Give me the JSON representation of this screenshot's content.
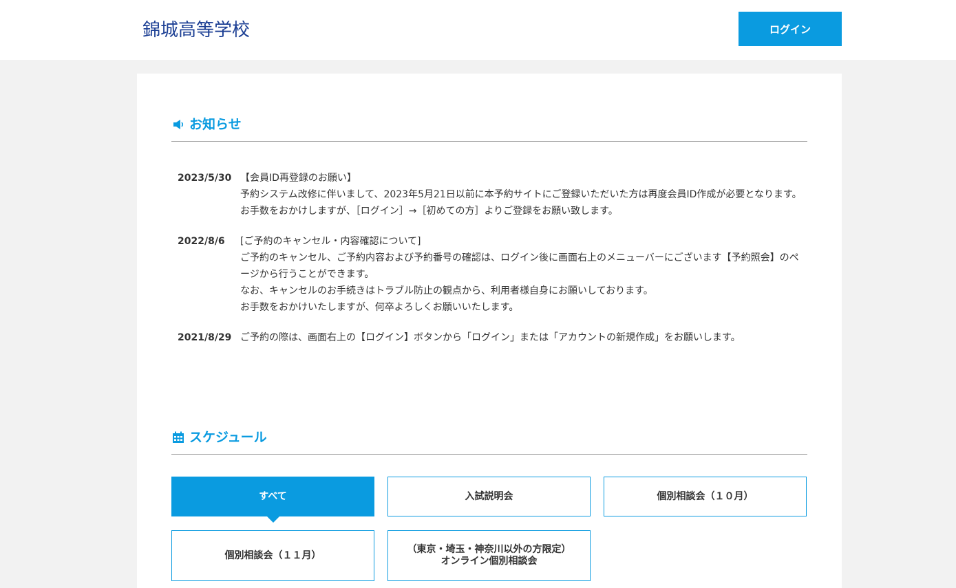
{
  "header": {
    "logo": "錦城高等学校",
    "login_label": "ログイン"
  },
  "colors": {
    "accent": "#0a9be0",
    "logo": "#1c3f94",
    "background": "#f2f2f2"
  },
  "news": {
    "title": "お知らせ",
    "icon": "megaphone-icon",
    "items": [
      {
        "date": "2023/5/30",
        "lines": [
          "【会員ID再登録のお願い】",
          "予約システム改修に伴いまして、2023年5月21日以前に本予約サイトにご登録いただいた方は再度会員ID作成が必要となります。",
          "お手数をおかけしますが、［ログイン］→［初めての方］よりご登録をお願い致します。"
        ]
      },
      {
        "date": "2022/8/6",
        "lines": [
          "[ご予約のキャンセル・内容確認について]",
          "ご予約のキャンセル、ご予約内容および予約番号の確認は、ログイン後に画面右上のメニューバーにございます【予約照会】のページから行うことができます。",
          "なお、キャンセルのお手続きはトラブル防止の観点から、利用者様自身にお願いしております。",
          "お手数をおかけいたしますが、何卒よろしくお願いいたします。"
        ]
      },
      {
        "date": "2021/8/29",
        "lines": [
          "ご予約の際は、画面右上の【ログイン】ボタンから「ログイン」または「アカウントの新規作成」をお願いします。"
        ]
      }
    ]
  },
  "schedule": {
    "title": "スケジュール",
    "icon": "calendar-icon",
    "tabs": [
      {
        "line1": "すべて",
        "line2": "",
        "active": true
      },
      {
        "line1": "入試説明会",
        "line2": "",
        "active": false
      },
      {
        "line1": "個別相談会（１０月）",
        "line2": "",
        "active": false
      },
      {
        "line1": "個別相談会（１１月）",
        "line2": "",
        "active": false
      },
      {
        "line1": "（東京・埼玉・神奈川以外の方限定）",
        "line2": "オンライン個別相談会",
        "active": false
      }
    ]
  }
}
